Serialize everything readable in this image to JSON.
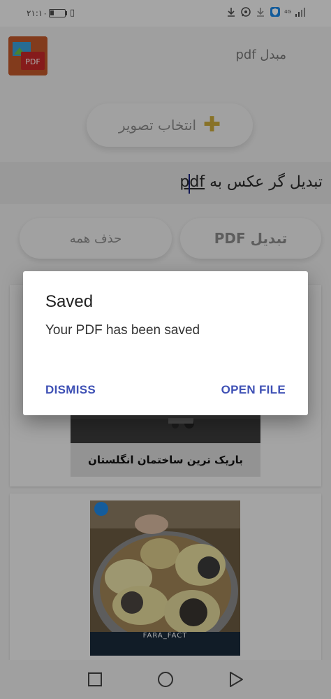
{
  "status_bar": {
    "time": "۲۱:۱۰",
    "battery_level": 0.2,
    "network_label": "4G"
  },
  "app": {
    "title": "مبدل pdf",
    "logo_text": "PDF"
  },
  "pick_button": {
    "label": "انتخاب تصویر"
  },
  "title_band": {
    "text_prefix": "تبدیل گر عکس به ",
    "text_highlight": "pdf"
  },
  "actions": {
    "delete_all": "حذف همه",
    "convert": "تبدیل PDF"
  },
  "cards": [
    {
      "caption": "باریک ترین ساختمان انگلستان"
    },
    {
      "caption": "FARA_FACT"
    }
  ],
  "dialog": {
    "title": "Saved",
    "message": "Your PDF has been saved",
    "dismiss": "DISMISS",
    "open_file": "OPEN FILE"
  }
}
